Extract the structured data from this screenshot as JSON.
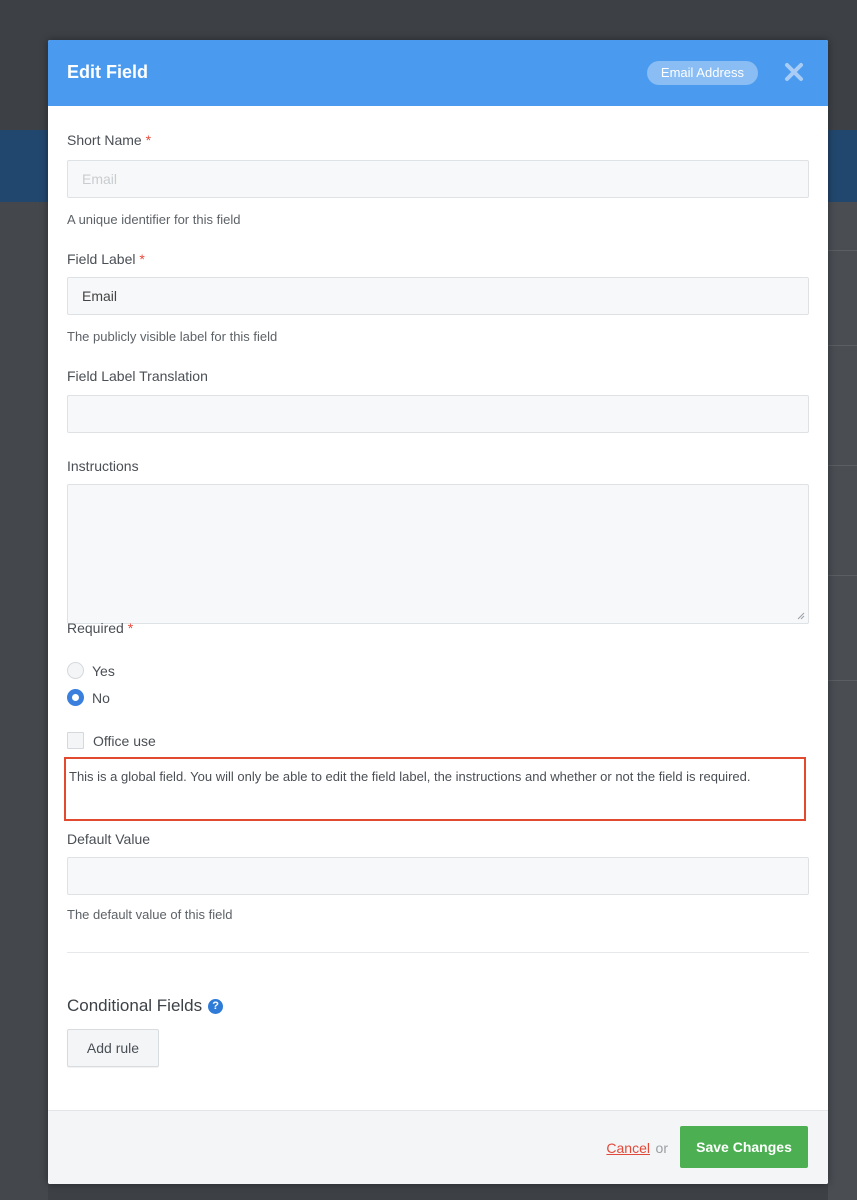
{
  "modal": {
    "title": "Edit Field",
    "badge": "Email Address",
    "close_icon": "close-icon",
    "accent_color": "#4a9bf0"
  },
  "form": {
    "short_name": {
      "label": "Short Name",
      "required_mark": "*",
      "placeholder": "Email",
      "help": "A unique identifier for this field"
    },
    "field_label": {
      "label": "Field Label",
      "required_mark": "*",
      "value": "Email",
      "help": "The publicly visible label for this field"
    },
    "field_label_translation": {
      "label": "Field Label Translation",
      "value": ""
    },
    "instructions": {
      "label": "Instructions",
      "value": ""
    },
    "required": {
      "label": "Required",
      "required_mark": "*",
      "options": [
        "Yes",
        "No"
      ],
      "selected": "No"
    },
    "office_use": {
      "label": "Office use",
      "checked": false
    },
    "global_notice": "This is a global field. You will only be able to edit the field label, the instructions and whether or not the field is required.",
    "default_value": {
      "label": "Default Value",
      "value": "",
      "help": "The default value of this field"
    }
  },
  "conditional": {
    "title": "Conditional Fields",
    "help_icon": "question-circle-icon",
    "add_rule_label": "Add rule"
  },
  "footer": {
    "cancel_label": "Cancel",
    "or_label": "or",
    "save_label": "Save Changes",
    "save_color": "#4cb052"
  }
}
